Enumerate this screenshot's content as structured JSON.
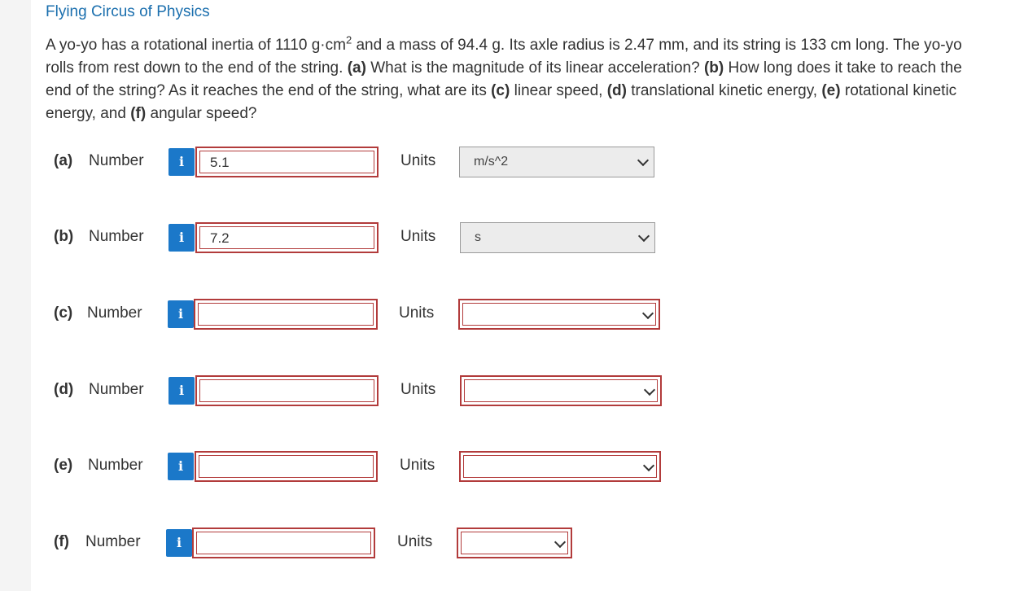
{
  "header": {
    "title": "Flying Circus of Physics"
  },
  "question": {
    "p1": "A yo-yo has a rotational inertia of 1110 g·cm",
    "sup": "2",
    "p2": " and a mass of 94.4 g. Its axle radius is 2.47 mm, and its string is 133 cm long. The yo-yo rolls from rest down to the end of the string. ",
    "a_label": "(a)",
    "a_text": " What is the magnitude of its linear acceleration? ",
    "b_label": "(b)",
    "b_text": " How long does it take to reach the end of the string? As it reaches the end of the string, what are its ",
    "c_label": "(c)",
    "c_text": " linear speed, ",
    "d_label": "(d)",
    "d_text": " translational kinetic energy, ",
    "e_label": "(e)",
    "e_text": " rotational kinetic energy, and ",
    "f_label": "(f)",
    "f_text": " angular speed?"
  },
  "answers": [
    {
      "part": "(a)",
      "number_label": "Number",
      "info": "i",
      "value": "5.1",
      "units_label": "Units",
      "unit": "m/s^2"
    },
    {
      "part": "(b)",
      "number_label": "Number",
      "info": "i",
      "value": "7.2",
      "units_label": "Units",
      "unit": "s"
    },
    {
      "part": "(c)",
      "number_label": "Number",
      "info": "i",
      "value": "",
      "units_label": "Units",
      "unit": ""
    },
    {
      "part": "(d)",
      "number_label": "Number",
      "info": "i",
      "value": "",
      "units_label": "Units",
      "unit": ""
    },
    {
      "part": "(e)",
      "number_label": "Number",
      "info": "i",
      "value": "",
      "units_label": "Units",
      "unit": ""
    },
    {
      "part": "(f)",
      "number_label": "Number",
      "info": "i",
      "value": "",
      "units_label": "Units",
      "unit": ""
    }
  ],
  "colors": {
    "accent": "#1b78c9",
    "error_border": "#b23b3b",
    "title": "#1b6fae"
  },
  "icons": {
    "info": "info-icon",
    "dropdown": "chevron-down-icon"
  }
}
